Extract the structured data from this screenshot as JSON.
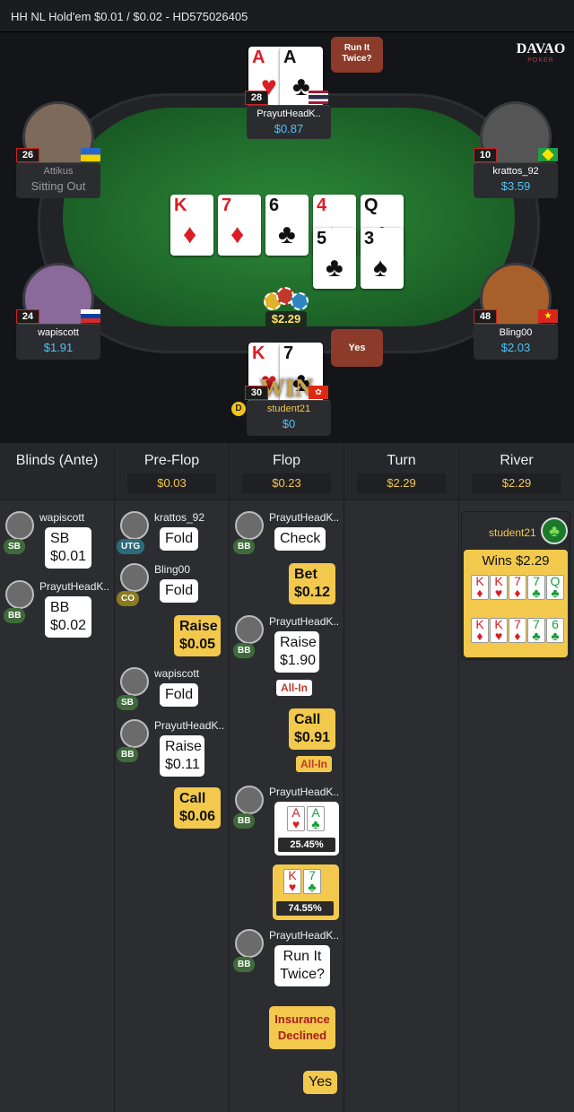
{
  "title": "HH NL Hold'em $0.01 / $0.02   - HD575026405",
  "logo": {
    "top": "DAVAO",
    "bottom": "POKER"
  },
  "players": {
    "prayut": {
      "name": "PrayutHeadK..",
      "stack": "$0.87",
      "level": "28"
    },
    "attikus": {
      "name": "Attikus",
      "status": "Sitting Out",
      "level": "26"
    },
    "krattos": {
      "name": "krattos_92",
      "stack": "$3.59",
      "level": "10"
    },
    "wapiscott": {
      "name": "wapiscott",
      "stack": "$1.91",
      "level": "24"
    },
    "bling": {
      "name": "Bling00",
      "stack": "$2.03",
      "level": "48"
    },
    "student": {
      "name": "student21",
      "stack": "$0",
      "level": "30"
    }
  },
  "bubbles": {
    "run_it_twice": "Run It Twice?",
    "yes": "Yes"
  },
  "pot": "$2.29",
  "win_text": "WIN",
  "dealer": "D",
  "board": [
    {
      "rank": "K",
      "suit": "♦",
      "color": "red"
    },
    {
      "rank": "7",
      "suit": "♦",
      "color": "red"
    },
    {
      "rank": "6",
      "suit": "♣",
      "color": "blk"
    },
    {
      "rank": "4",
      "suit": "♦",
      "color": "red"
    },
    {
      "rank": "Q",
      "suit": "♣",
      "color": "blk"
    },
    {
      "rank": "5",
      "suit": "♣",
      "color": "blk"
    },
    {
      "rank": "3",
      "suit": "♠",
      "color": "blk"
    }
  ],
  "hole_prayut": [
    {
      "rank": "A",
      "suit": "♥",
      "color": "red"
    },
    {
      "rank": "A",
      "suit": "♣",
      "color": "blk"
    }
  ],
  "hole_student": [
    {
      "rank": "K",
      "suit": "♥",
      "color": "red"
    },
    {
      "rank": "7",
      "suit": "♣",
      "color": "blk"
    }
  ],
  "history": {
    "cols": [
      {
        "title": "Blinds (Ante)",
        "pot": ""
      },
      {
        "title": "Pre-Flop",
        "pot": "$0.03"
      },
      {
        "title": "Flop",
        "pot": "$0.23"
      },
      {
        "title": "Turn",
        "pot": "$2.29"
      },
      {
        "title": "River",
        "pot": "$2.29"
      }
    ],
    "blinds": {
      "p1": {
        "name": "wapiscott",
        "pos": "SB",
        "line1": "SB",
        "line2": "$0.01"
      },
      "p2": {
        "name": "PrayutHeadK..",
        "pos": "BB",
        "line1": "BB",
        "line2": "$0.02"
      }
    },
    "preflop": {
      "p1": {
        "name": "krattos_92",
        "pos": "UTG",
        "action": "Fold"
      },
      "p2": {
        "name": "Bling00",
        "pos": "CO",
        "action": "Fold"
      },
      "hero_raise": {
        "line1": "Raise",
        "line2": "$0.05"
      },
      "p3": {
        "name": "wapiscott",
        "pos": "SB",
        "action": "Fold"
      },
      "p4": {
        "name": "PrayutHeadK..",
        "pos": "BB",
        "line1": "Raise",
        "line2": "$0.11"
      },
      "hero_call": {
        "line1": "Call",
        "line2": "$0.06"
      }
    },
    "flop": {
      "p1": {
        "name": "PrayutHeadK..",
        "pos": "BB",
        "action": "Check"
      },
      "hero_bet": {
        "line1": "Bet",
        "line2": "$0.12"
      },
      "p2": {
        "name": "PrayutHeadK..",
        "pos": "BB",
        "line1": "Raise",
        "line2": "$1.90"
      },
      "allin1": "All-In",
      "hero_call": {
        "line1": "Call",
        "line2": "$0.91"
      },
      "allin2": "All-In",
      "p3": {
        "name": "PrayutHeadK..",
        "pos": "BB",
        "pct": "25.45%"
      },
      "hero_pct": "74.55%",
      "p4": {
        "name": "PrayutHeadK..",
        "pos": "BB",
        "line1": "Run It",
        "line2": "Twice?"
      },
      "insurance": {
        "line1": "Insurance",
        "line2": "Declined"
      },
      "yes": "Yes"
    },
    "river": {
      "name": "student21",
      "wins": "Wins $2.29",
      "row1": [
        {
          "r": "K",
          "s": "♦",
          "c": "red"
        },
        {
          "r": "K",
          "s": "♥",
          "c": "red"
        },
        {
          "r": "7",
          "s": "♦",
          "c": "red"
        },
        {
          "r": "7",
          "s": "♣",
          "c": "grn"
        },
        {
          "r": "Q",
          "s": "♣",
          "c": "grn"
        }
      ],
      "row2": [
        {
          "r": "K",
          "s": "♦",
          "c": "red"
        },
        {
          "r": "K",
          "s": "♥",
          "c": "red"
        },
        {
          "r": "7",
          "s": "♦",
          "c": "red"
        },
        {
          "r": "7",
          "s": "♣",
          "c": "grn"
        },
        {
          "r": "6",
          "s": "♣",
          "c": "grn"
        }
      ]
    }
  }
}
